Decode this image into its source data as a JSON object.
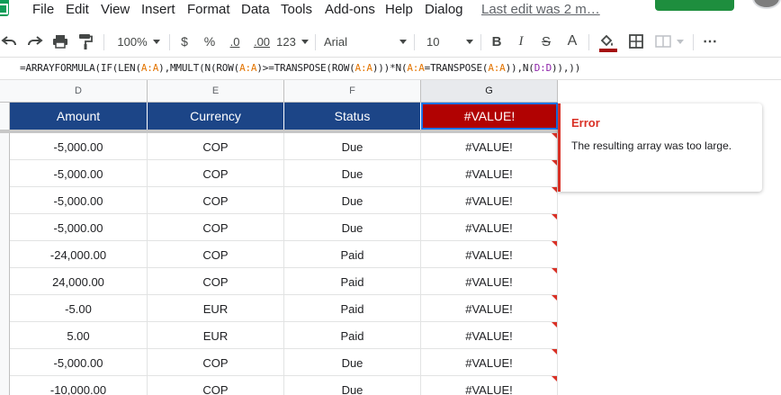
{
  "menu": {
    "items": [
      "File",
      "Edit",
      "View",
      "Insert",
      "Format",
      "Data",
      "Tools",
      "Add-ons",
      "Help",
      "Dialog"
    ],
    "last_edit": "Last edit was 2 m…"
  },
  "toolbar": {
    "zoom": "100%",
    "currency": "$",
    "percent": "%",
    "decrease_decimals": ".0",
    "increase_decimals": ".00",
    "more_formats": "123",
    "font": "Arial",
    "font_size": "10",
    "bold": "B",
    "italic": "I",
    "strikethrough": "S",
    "text_color": "A",
    "more": "⋯"
  },
  "formula_bar": {
    "parts": [
      {
        "t": "=ARRAYFORMULA(IF(LEN(",
        "c": ""
      },
      {
        "t": "A:A",
        "c": "a"
      },
      {
        "t": "),MMULT(N(ROW(",
        "c": ""
      },
      {
        "t": "A:A",
        "c": "a"
      },
      {
        "t": ")>=TRANSPOSE(ROW(",
        "c": ""
      },
      {
        "t": "A:A",
        "c": "a"
      },
      {
        "t": ")))*N(",
        "c": ""
      },
      {
        "t": "A:A",
        "c": "a"
      },
      {
        "t": "=TRANSPOSE(",
        "c": ""
      },
      {
        "t": "A:A",
        "c": "a"
      },
      {
        "t": ")),N(",
        "c": ""
      },
      {
        "t": "D:D",
        "c": "d"
      },
      {
        "t": ")),))",
        "c": ""
      }
    ]
  },
  "columns": [
    "D",
    "E",
    "F",
    "G"
  ],
  "headers": [
    "Amount",
    "Currency",
    "Status",
    "#VALUE!"
  ],
  "rows": [
    [
      "-5,000.00",
      "COP",
      "Due",
      "#VALUE!"
    ],
    [
      "-5,000.00",
      "COP",
      "Due",
      "#VALUE!"
    ],
    [
      "-5,000.00",
      "COP",
      "Due",
      "#VALUE!"
    ],
    [
      "-5,000.00",
      "COP",
      "Due",
      "#VALUE!"
    ],
    [
      "-24,000.00",
      "COP",
      "Paid",
      "#VALUE!"
    ],
    [
      "24,000.00",
      "COP",
      "Paid",
      "#VALUE!"
    ],
    [
      "-5.00",
      "EUR",
      "Paid",
      "#VALUE!"
    ],
    [
      "5.00",
      "EUR",
      "Paid",
      "#VALUE!"
    ],
    [
      "-5,000.00",
      "COP",
      "Due",
      "#VALUE!"
    ],
    [
      "-10,000.00",
      "COP",
      "Due",
      "#VALUE!"
    ]
  ],
  "error": {
    "title": "Error",
    "message": "The resulting array was too large."
  },
  "colors": {
    "header_bg": "#1c4587",
    "error_bg": "#b10202",
    "error_accent": "#d93025",
    "fill_color": "#a50e0e"
  }
}
